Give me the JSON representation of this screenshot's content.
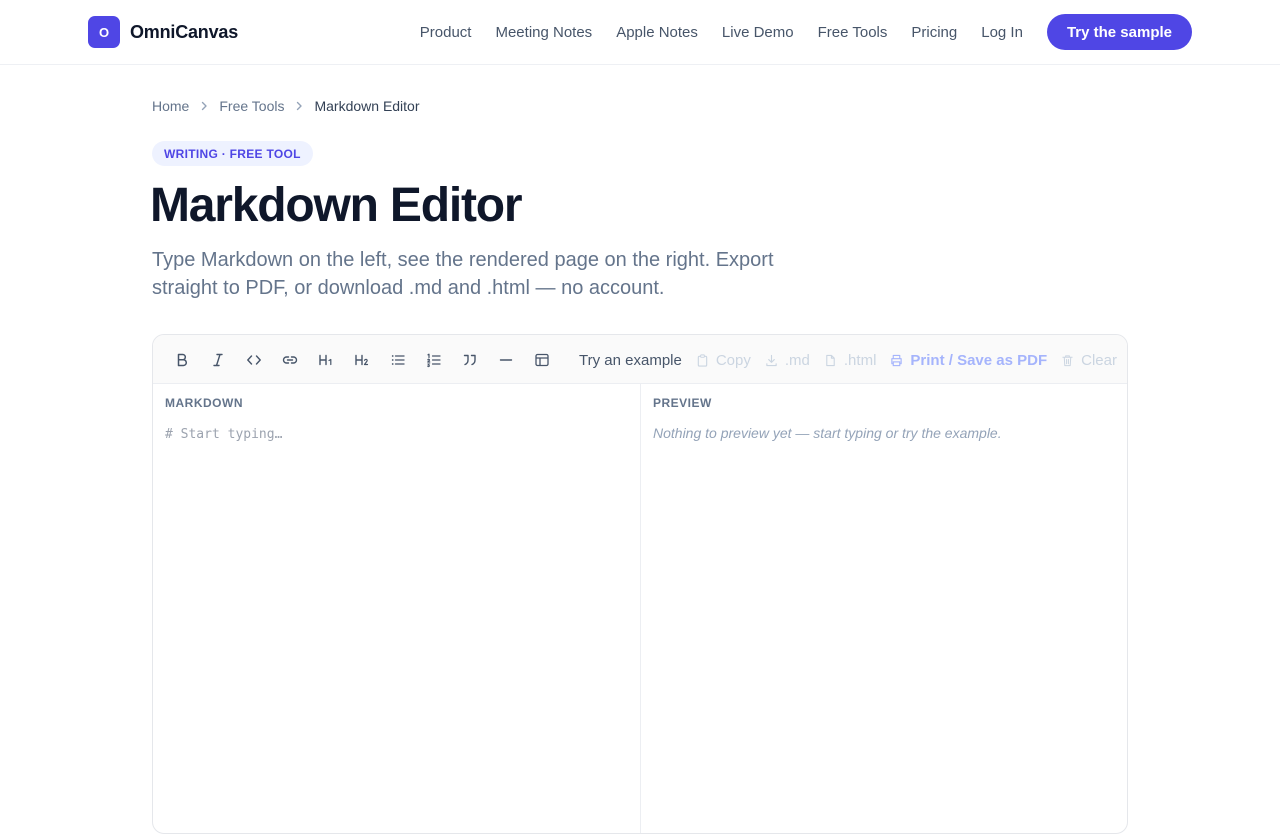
{
  "header": {
    "logo_letter": "O",
    "brand": "OmniCanvas",
    "nav": [
      "Product",
      "Meeting Notes",
      "Apple Notes",
      "Live Demo",
      "Free Tools",
      "Pricing",
      "Log In"
    ],
    "cta": "Try the sample"
  },
  "breadcrumb": {
    "items": [
      "Home",
      "Free Tools"
    ],
    "current": "Markdown Editor"
  },
  "hero": {
    "tag": "WRITING · FREE TOOL",
    "title": "Markdown Editor",
    "subtitle": "Type Markdown on the left, see the rendered page on the right. Export straight to PDF, or download .md and .html — no account."
  },
  "toolbar": {
    "format_buttons": [
      "bold-icon",
      "italic-icon",
      "code-icon",
      "link-icon",
      "heading-1-icon",
      "heading-2-icon",
      "bullet-list-icon",
      "numbered-list-icon",
      "quote-icon",
      "horizontal-rule-icon",
      "table-icon"
    ],
    "try_example": "Try an example",
    "copy": "Copy",
    "download_md": ".md",
    "download_html": ".html",
    "print_pdf": "Print / Save as PDF",
    "clear": "Clear"
  },
  "markdown_pane": {
    "label": "MARKDOWN",
    "value": "",
    "placeholder": "# Start typing…"
  },
  "preview_pane": {
    "label": "PREVIEW",
    "empty_text": "Nothing to preview yet — start typing or try the example."
  },
  "colors": {
    "accent": "#4f46e5",
    "accent_light": "#eef2ff",
    "text_dark": "#0f172a",
    "text_muted": "#64748b"
  }
}
